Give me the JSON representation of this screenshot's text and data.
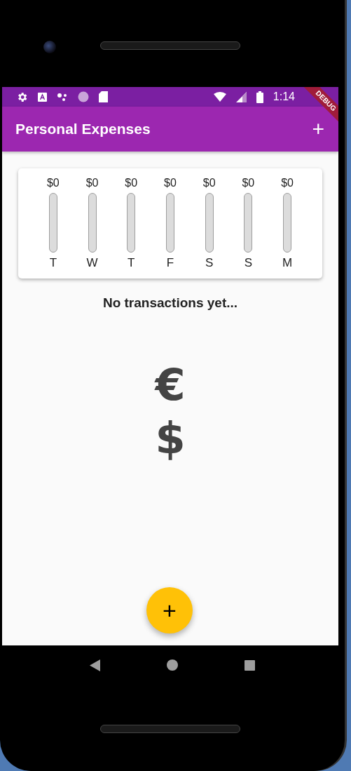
{
  "status_bar": {
    "time": "1:14"
  },
  "debug_banner": {
    "label": "DEBUG"
  },
  "app_bar": {
    "title": "Personal Expenses",
    "action": "+"
  },
  "chart": {
    "bars": [
      {
        "amount": "$0",
        "day": "T",
        "level": 0
      },
      {
        "amount": "$0",
        "day": "W",
        "level": 0
      },
      {
        "amount": "$0",
        "day": "T",
        "level": 0
      },
      {
        "amount": "$0",
        "day": "F",
        "level": 0
      },
      {
        "amount": "$0",
        "day": "S",
        "level": 0
      },
      {
        "amount": "$0",
        "day": "S",
        "level": 0
      },
      {
        "amount": "$0",
        "day": "M",
        "level": 0
      }
    ]
  },
  "empty_state": {
    "message": "No transactions yet...",
    "symbols": [
      "€",
      "$"
    ]
  },
  "fab": {
    "label": "+"
  }
}
